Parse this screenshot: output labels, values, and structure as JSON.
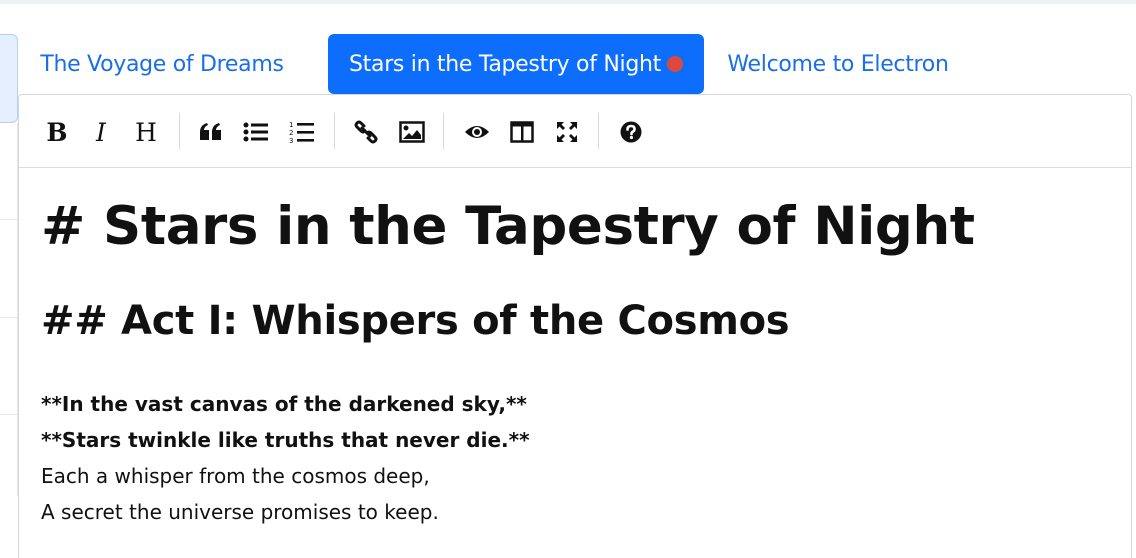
{
  "tabs": [
    {
      "label": "The Voyage of Dreams",
      "active": false
    },
    {
      "label": "Stars in the Tapestry of Night",
      "active": true,
      "unsaved": true
    },
    {
      "label": "Welcome to Electron",
      "active": false
    }
  ],
  "toolbar": {
    "bold": "B",
    "italic": "I",
    "heading": "H"
  },
  "document": {
    "h1": "# Stars in the Tapestry of Night",
    "h2": "## Act I: Whispers of the Cosmos",
    "lines": [
      "**In the vast canvas of the darkened sky,**",
      "**Stars twinkle like truths that never die.**",
      "Each a whisper from the cosmos deep,",
      "A secret the universe promises to keep."
    ]
  },
  "colors": {
    "accent": "#0d6efd",
    "tab_text": "#1a6fe8",
    "unsaved_dot": "#dc4a3d"
  }
}
